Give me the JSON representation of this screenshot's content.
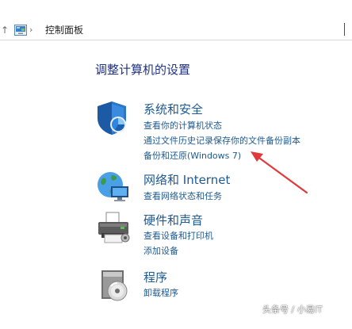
{
  "address_bar": {
    "separator": "›",
    "breadcrumb": "控制面板"
  },
  "page_title": "调整计算机的设置",
  "categories": [
    {
      "title": "系统和安全",
      "icon": "shield-icon",
      "links": [
        "查看你的计算机状态",
        "通过文件历史记录保存你的文件备份副本",
        "备份和还原(Windows 7)"
      ]
    },
    {
      "title": "网络和 Internet",
      "icon": "network-globe-icon",
      "links": [
        "查看网络状态和任务"
      ]
    },
    {
      "title": "硬件和声音",
      "icon": "printer-icon",
      "links": [
        "查看设备和打印机",
        "添加设备"
      ]
    },
    {
      "title": "程序",
      "icon": "programs-icon",
      "links": [
        "卸载程序"
      ]
    }
  ],
  "annotation": {
    "color": "#e03b3b",
    "points_to": "备份和还原(Windows 7)"
  },
  "watermark": "头条号 / 小易IT",
  "colors": {
    "link": "#1e5a8f",
    "title": "#1e3287"
  }
}
